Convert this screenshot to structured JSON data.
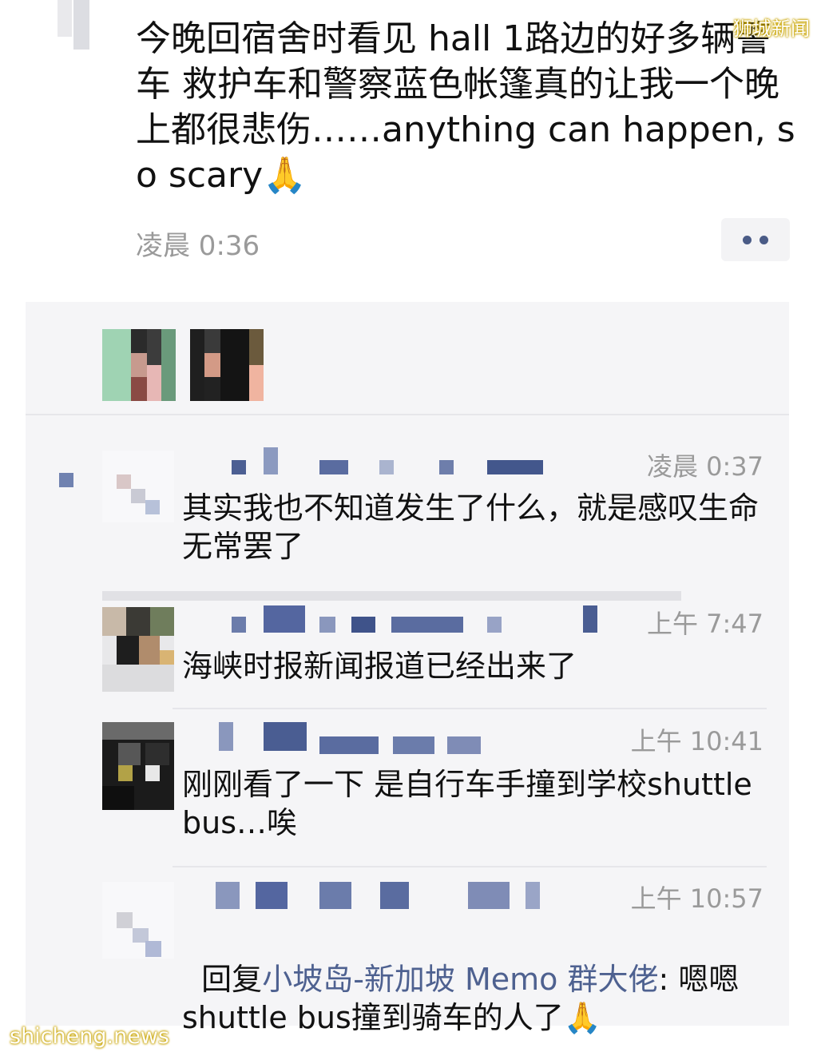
{
  "post": {
    "text": "今晚回宿舍时看见 hall 1路边的好多辆警车 救护车和警察蓝色帐篷真的让我一个晚上都很悲伤……anything can happen, so scary🙏",
    "time": "凌晨 0:36"
  },
  "comments": [
    {
      "time": "凌晨 0:37",
      "text": "其实我也不知道发生了什么，就是感叹生命无常罢了"
    },
    {
      "time": "上午 7:47",
      "text": "海峡时报新闻报道已经出来了"
    },
    {
      "time": "上午 10:41",
      "text": "刚刚看了一下 是自行车手撞到学校shuttle bus…唉"
    },
    {
      "time": "上午 10:57",
      "reply_prefix": "回复",
      "reply_to": "小坡岛-新加坡 Memo 群大佬",
      "reply_sep": ": ",
      "text": "嗯嗯shuttle bus撞到骑车的人了🙏"
    }
  ],
  "watermarks": {
    "top_right": "狮城新闻",
    "bottom_left": "shicheng.news"
  },
  "colors": {
    "name_link": "#4e6190",
    "panel_bg": "#f5f5f7",
    "timestamp": "#9a9a9a"
  }
}
